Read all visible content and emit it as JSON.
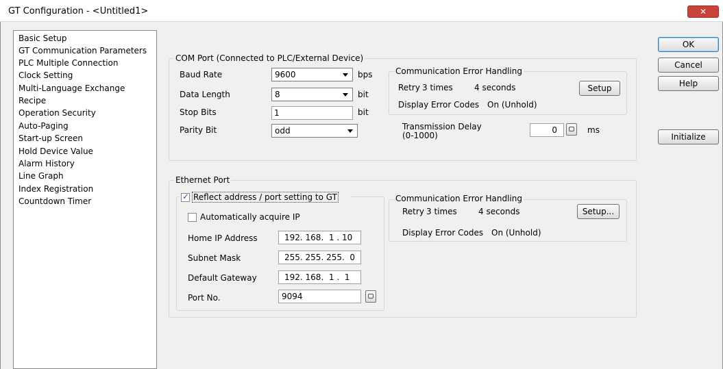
{
  "window": {
    "title": "GT Configuration - <Untitled1>",
    "close_glyph": "✕"
  },
  "nav": {
    "items": [
      "Basic Setup",
      "GT Communication Parameters",
      "PLC Multiple Connection",
      "Clock Setting",
      "Multi-Language Exchange",
      "Recipe",
      "Operation Security",
      "Auto-Paging",
      "Start-up Screen",
      "Hold Device Value",
      "Alarm History",
      "Line Graph",
      "Index Registration",
      "Countdown Timer"
    ],
    "selected": "GT Communication Parameters"
  },
  "com_port": {
    "legend": "COM Port (Connected to PLC/External Device)",
    "baud_rate": {
      "label": "Baud Rate",
      "value": "9600",
      "unit": "bps"
    },
    "data_length": {
      "label": "Data Length",
      "value": "8",
      "unit": "bit"
    },
    "stop_bits": {
      "label": "Stop Bits",
      "value": "1",
      "unit": "bit"
    },
    "parity_bit": {
      "label": "Parity Bit",
      "value": "odd"
    },
    "error_handling": {
      "legend": "Communication Error Handling",
      "retry_label": "Retry",
      "retry_times": "3 times",
      "retry_seconds": "4 seconds",
      "setup_button": "Setup",
      "display_label": "Display Error Codes",
      "display_value": "On (Unhold)"
    },
    "transmission_delay": {
      "label": "Transmission Delay",
      "range": "(0-1000)",
      "value": "0",
      "unit": "ms"
    }
  },
  "ethernet_port": {
    "legend": "Ethernet Port",
    "reflect": {
      "label": "Reflect address / port setting to GT",
      "checked": true
    },
    "auto_ip": {
      "label": "Automatically acquire IP",
      "checked": false
    },
    "home_ip": {
      "label": "Home IP Address",
      "value": "192. 168.  1 . 10"
    },
    "subnet_mask": {
      "label": "Subnet Mask",
      "value": "255. 255. 255.  0"
    },
    "gateway": {
      "label": "Default Gateway",
      "value": "192. 168.  1 .  1"
    },
    "port_no": {
      "label": "Port No.",
      "value": "9094"
    },
    "error_handling": {
      "legend": "Communication Error Handling",
      "retry_label": "Retry",
      "retry_times": "3 times",
      "retry_seconds": "4 seconds",
      "setup_button": "Setup...",
      "display_label": "Display Error Codes",
      "display_value": "On (Unhold)"
    }
  },
  "buttons": {
    "ok": "OK",
    "cancel": "Cancel",
    "help": "Help",
    "initialize": "Initialize"
  },
  "colors": {
    "check": "#2a55c0",
    "close": "#c8433a",
    "selection": "#ffffff"
  }
}
